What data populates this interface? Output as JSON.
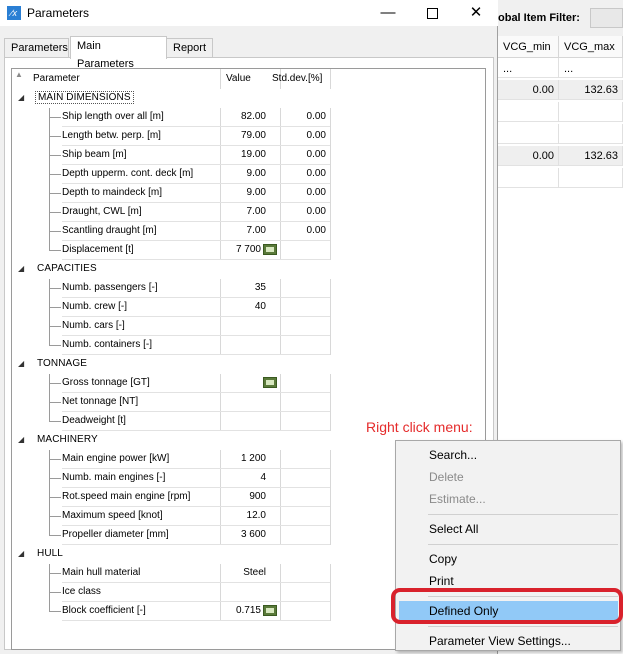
{
  "window": {
    "title": "Parameters",
    "minimize_glyph": "—",
    "close_glyph": "✕"
  },
  "tabs": [
    {
      "label": "Parameters",
      "active": false
    },
    {
      "label": "Main Parameters",
      "active": true
    },
    {
      "label": "Report",
      "active": false
    }
  ],
  "grid": {
    "columns": {
      "parameter": "Parameter",
      "value": "Value",
      "std": "Std.dev.[%]"
    },
    "sort_icon": "▲",
    "groups": [
      {
        "name": "MAIN DIMENSIONS",
        "rows": [
          {
            "label": "Ship length over all [m]",
            "value": "82.00",
            "std": "0.00",
            "calc": false
          },
          {
            "label": "Length betw. perp. [m]",
            "value": "79.00",
            "std": "0.00",
            "calc": false
          },
          {
            "label": "Ship beam [m]",
            "value": "19.00",
            "std": "0.00",
            "calc": false
          },
          {
            "label": "Depth upperm. cont. deck [m]",
            "value": "9.00",
            "std": "0.00",
            "calc": false
          },
          {
            "label": "Depth to maindeck [m]",
            "value": "9.00",
            "std": "0.00",
            "calc": false
          },
          {
            "label": "Draught, CWL [m]",
            "value": "7.00",
            "std": "0.00",
            "calc": false
          },
          {
            "label": "Scantling draught [m]",
            "value": "7.00",
            "std": "0.00",
            "calc": false
          },
          {
            "label": "Displacement [t]",
            "value": "7 700",
            "std": "",
            "calc": true
          }
        ]
      },
      {
        "name": "CAPACITIES",
        "rows": [
          {
            "label": "Numb. passengers [-]",
            "value": "35",
            "std": "",
            "calc": false
          },
          {
            "label": "Numb. crew [-]",
            "value": "40",
            "std": "",
            "calc": false
          },
          {
            "label": "Numb. cars [-]",
            "value": "",
            "std": "",
            "calc": false
          },
          {
            "label": "Numb. containers [-]",
            "value": "",
            "std": "",
            "calc": false
          }
        ]
      },
      {
        "name": "TONNAGE",
        "rows": [
          {
            "label": "Gross tonnage [GT]",
            "value": "",
            "std": "",
            "calc": true
          },
          {
            "label": "Net tonnage [NT]",
            "value": "",
            "std": "",
            "calc": false
          },
          {
            "label": "Deadweight [t]",
            "value": "",
            "std": "",
            "calc": false
          }
        ]
      },
      {
        "name": "MACHINERY",
        "rows": [
          {
            "label": "Main engine power [kW]",
            "value": "1 200",
            "std": "",
            "calc": false
          },
          {
            "label": "Numb. main engines [-]",
            "value": "4",
            "std": "",
            "calc": false
          },
          {
            "label": "Rot.speed main engine [rpm]",
            "value": "900",
            "std": "",
            "calc": false
          },
          {
            "label": "Maximum speed [knot]",
            "value": "12.0",
            "std": "",
            "calc": false
          },
          {
            "label": "Propeller diameter [mm]",
            "value": "3 600",
            "std": "",
            "calc": false
          }
        ]
      },
      {
        "name": "HULL",
        "rows": [
          {
            "label": "Main hull material",
            "value": "Steel",
            "std": "",
            "calc": false
          },
          {
            "label": "Ice class",
            "value": "",
            "std": "",
            "calc": false
          },
          {
            "label": "Block coefficient [-]",
            "value": "0.715",
            "std": "",
            "calc": true
          }
        ]
      }
    ]
  },
  "annotation": "Right click menu:",
  "context_menu": {
    "items": [
      {
        "label": "Search...",
        "disabled": false,
        "selected": false
      },
      {
        "label": "Delete",
        "disabled": true,
        "selected": false
      },
      {
        "label": "Estimate...",
        "disabled": true,
        "selected": false
      },
      {
        "separator": true
      },
      {
        "label": "Select All",
        "disabled": false,
        "selected": false
      },
      {
        "separator": true
      },
      {
        "label": "Copy",
        "disabled": false,
        "selected": false
      },
      {
        "label": "Print",
        "disabled": false,
        "selected": false
      },
      {
        "separator": true
      },
      {
        "label": "Defined Only",
        "disabled": false,
        "selected": true
      },
      {
        "separator": true
      },
      {
        "label": "Parameter View Settings...",
        "disabled": false,
        "selected": false
      }
    ],
    "highlight_color": "#d9222c"
  },
  "background_app": {
    "filter_label": "obal Item Filter:",
    "columns": [
      "VCG_min ...",
      "VCG_max ..."
    ],
    "rows": [
      {
        "vcg_min": "",
        "vcg_max": "",
        "shaded": false
      },
      {
        "vcg_min": "0.00",
        "vcg_max": "132.63",
        "shaded": true
      },
      {
        "vcg_min": "",
        "vcg_max": "",
        "shaded": false
      },
      {
        "vcg_min": "",
        "vcg_max": "",
        "shaded": false
      },
      {
        "vcg_min": "0.00",
        "vcg_max": "132.63",
        "shaded": true
      },
      {
        "vcg_min": "",
        "vcg_max": "",
        "shaded": false
      }
    ]
  }
}
